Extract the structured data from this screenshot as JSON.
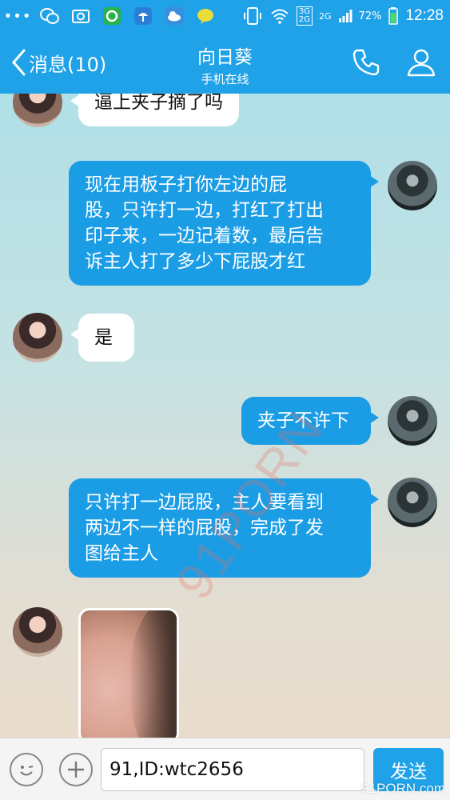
{
  "status_bar": {
    "time": "12:28",
    "battery": "72%",
    "network_top": "3G",
    "network_bottom": "2G",
    "network_2g": "2G",
    "notifications": [
      "more-icon",
      "wechat-icon",
      "screenshot-icon",
      "app-icon",
      "weather-icon",
      "cloud-icon",
      "chat-bubble-icon"
    ]
  },
  "header": {
    "back_label": "消息(10)",
    "title": "向日葵",
    "subtitle": "手机在线"
  },
  "messages": [
    {
      "side": "in",
      "text": "逼上夹子摘了吗"
    },
    {
      "side": "out",
      "text": "现在用板子打你左边的屁\n股，只许打一边，打红了打出\n印子来，一边记着数，最后告\n诉主人打了多少下屁股才红"
    },
    {
      "side": "in",
      "text": "是"
    },
    {
      "side": "out",
      "text": "夹子不许下"
    },
    {
      "side": "out",
      "text": "只许打一边屁股，主人要看到\n两边不一样的屁股，完成了发\n图给主人"
    }
  ],
  "watermark": "91PORN",
  "input": {
    "value": "91,ID:wtc2656",
    "send_label": "发送"
  },
  "corner_mark": "91PORN.com",
  "colors": {
    "accent": "#1fa2e8",
    "outgoing_bubble": "#1b9de6",
    "incoming_bubble": "#ffffff"
  }
}
